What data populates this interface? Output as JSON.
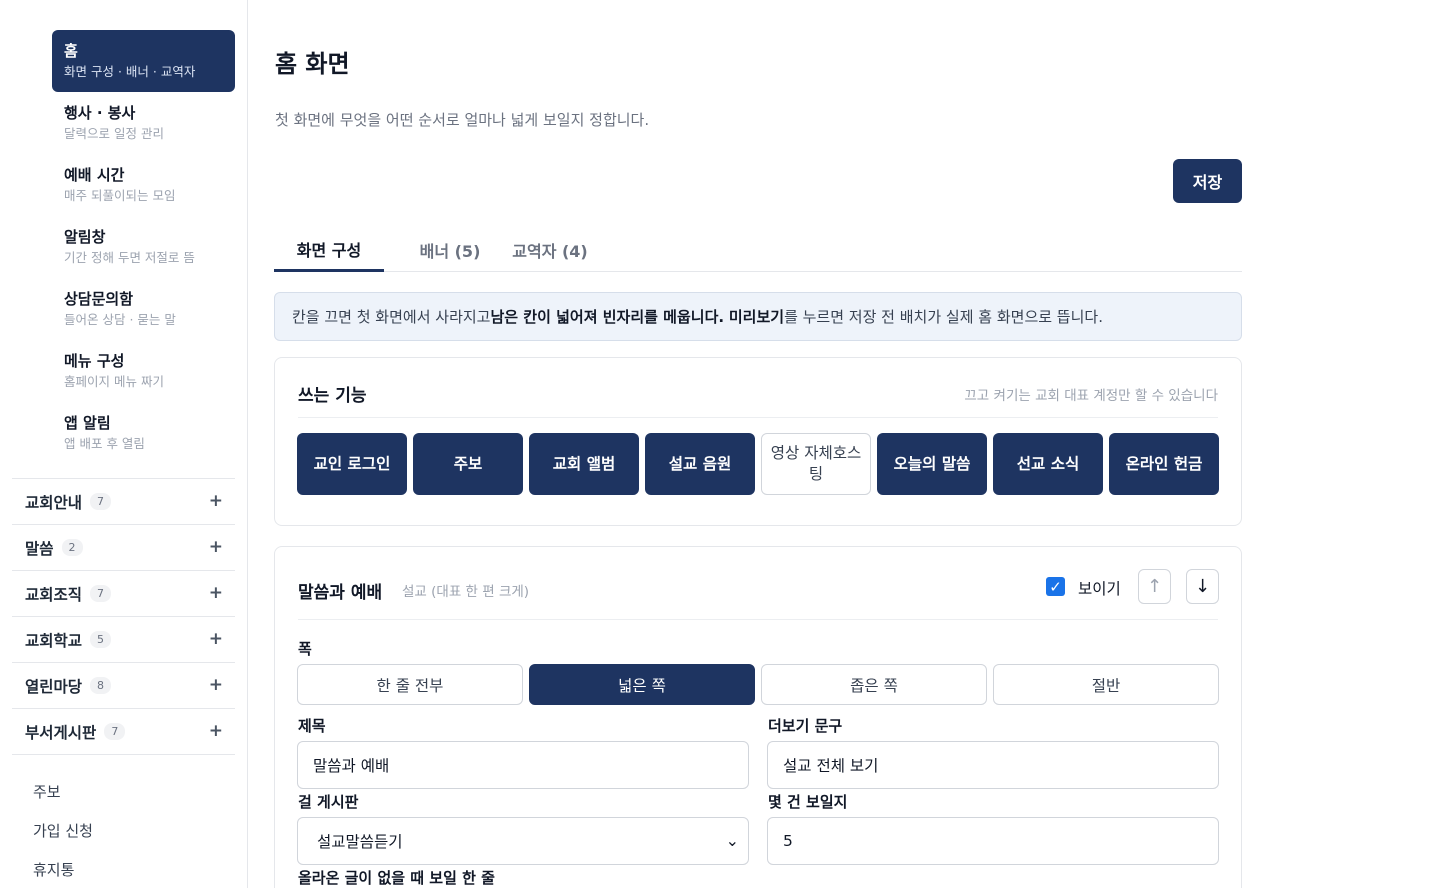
{
  "sidebar": {
    "nav": [
      {
        "title": "홈",
        "sub": "화면 구성 · 배너 · 교역자"
      },
      {
        "title": "행사 · 봉사",
        "sub": "달력으로 일정 관리"
      },
      {
        "title": "예배 시간",
        "sub": "매주 되풀이되는 모임"
      },
      {
        "title": "알림창",
        "sub": "기간 정해 두면 저절로 뜸"
      },
      {
        "title": "상담문의함",
        "sub": "들어온 상담 · 묻는 말"
      },
      {
        "title": "메뉴 구성",
        "sub": "홈페이지 메뉴 짜기"
      },
      {
        "title": "앱 알림",
        "sub": "앱 배포 후 열림"
      }
    ],
    "sections": [
      {
        "label": "교회안내",
        "count": "7"
      },
      {
        "label": "말씀",
        "count": "2"
      },
      {
        "label": "교회조직",
        "count": "7"
      },
      {
        "label": "교회학교",
        "count": "5"
      },
      {
        "label": "열린마당",
        "count": "8"
      },
      {
        "label": "부서게시판",
        "count": "7"
      }
    ],
    "links": [
      "주보",
      "가입 신청",
      "휴지통"
    ]
  },
  "page": {
    "title": "홈 화면",
    "description": "첫 화면에 무엇을 어떤 순서로 얼마나 넓게 보일지 정합니다.",
    "save_label": "저장"
  },
  "tabs": [
    "화면 구성",
    "배너 (5)",
    "교역자 (4)"
  ],
  "notice": {
    "part1": "칸을 끄면 첫 화면에서 사라지고 ",
    "bold1": "남은 칸이 넓어져 빈자리를 메웁니다.",
    "part2": " ",
    "bold2": "미리보기",
    "part3": "를 누르면 저장 전 배치가 실제 홈 화면으로 뜹니다."
  },
  "features": {
    "title": "쓰는 기능",
    "hint": "끄고 켜기는 교회 대표 계정만 할 수 있습니다",
    "items": [
      "교인 로그인",
      "주보",
      "교회 앨범",
      "설교 음원",
      "영상 자체호스팅",
      "오늘의 말씀",
      "선교 소식",
      "온라인 헌금"
    ]
  },
  "section_card": {
    "title": "말씀과 예배",
    "subtitle": "설교 (대표 한 편 크게)",
    "visible_label": "보이기",
    "check_mark": "✓",
    "up_arrow": "↑",
    "down_arrow": "↓",
    "width_label": "폭",
    "width_options": [
      "한 줄 전부",
      "넓은 쪽",
      "좁은 쪽",
      "절반"
    ],
    "title_label": "제목",
    "title_value": "말씀과 예배",
    "more_label": "더보기 문구",
    "more_value": "설교 전체 보기",
    "board_label": "걸 게시판",
    "board_value": "설교말씀듣기",
    "count_label": "몇 건 보일지",
    "count_value": "5",
    "empty_label": "올라온 글이 없을 때 보일 한 줄"
  },
  "icons": {
    "plus": "+",
    "chevron": "⌄"
  },
  "colors": {
    "primary": "#1e3461",
    "checkbox": "#1a73e8",
    "notice_bg": "#eef3fa"
  }
}
